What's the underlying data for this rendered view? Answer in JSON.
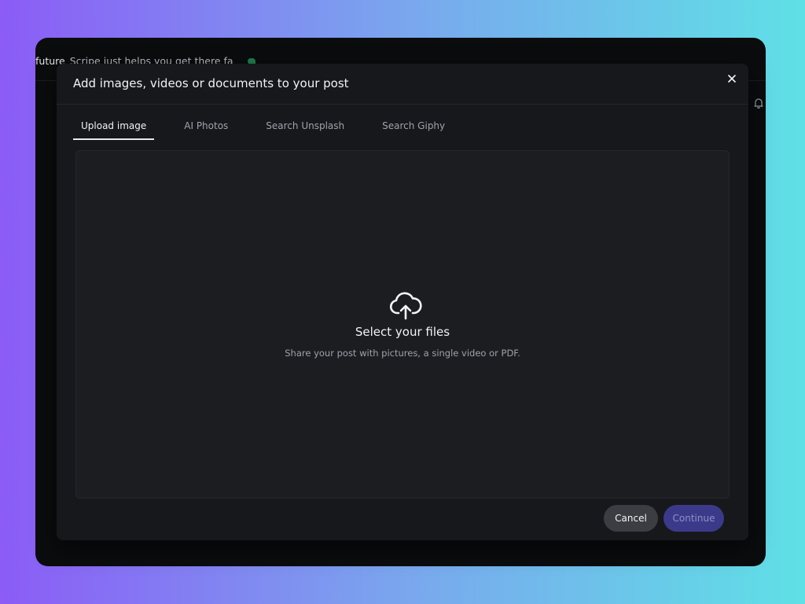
{
  "background": {
    "post_text_strong": "future",
    "post_text_rest": "Scripe just helps you get there fa"
  },
  "modal": {
    "title": "Add images, videos or documents to your post",
    "tabs": [
      {
        "label": "Upload image",
        "active": true
      },
      {
        "label": "AI Photos",
        "active": false
      },
      {
        "label": "Search Unsplash",
        "active": false
      },
      {
        "label": "Search Giphy",
        "active": false
      }
    ],
    "dropzone": {
      "title": "Select your files",
      "subtitle": "Share your post with pictures, a single video or PDF."
    },
    "footer": {
      "cancel_label": "Cancel",
      "continue_label": "Continue",
      "continue_disabled": true
    }
  },
  "icons": {
    "close": "close-icon",
    "upload": "cloud-upload-icon",
    "bell": "bell-icon",
    "leaf": "leaf-icon"
  },
  "colors": {
    "accent": "#3b3a8a",
    "modal_bg": "#17181b",
    "dropzone_bg": "#1c1d20"
  }
}
